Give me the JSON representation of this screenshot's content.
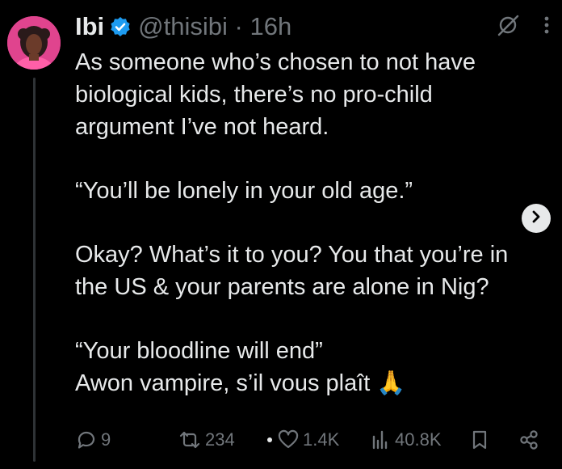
{
  "author": {
    "name": "Ibi",
    "handle": "@thisibi",
    "separator": "·",
    "time": "16h",
    "verified_icon": "verified-badge-icon",
    "avatar": "avatar"
  },
  "tweet": {
    "paragraphs": [
      [
        "As someone who’s chosen to not have",
        "biological kids, there’s no pro-child",
        "argument I’ve not heard."
      ],
      [
        "“You’ll be lonely in your old age.”"
      ],
      [
        "Okay? What’s it to you? You that you’re in",
        "the US & your parents are alone in Nig?"
      ],
      [
        "“Your bloodline will end”",
        "Awon vampire, s’il vous plaît 🙏"
      ]
    ]
  },
  "actions": {
    "replies": "9",
    "reposts": "234",
    "likes": "1.4K",
    "views": "40.8K"
  },
  "colors": {
    "background": "#000000",
    "text": "#e7e9ea",
    "muted": "#71767b",
    "verified": "#1d9bf0"
  },
  "icons": [
    "verified-badge-icon",
    "grok-icon",
    "more-icon",
    "chevron-right-icon",
    "reply-icon",
    "repost-icon",
    "like-icon",
    "views-icon",
    "bookmark-icon",
    "share-icon"
  ]
}
